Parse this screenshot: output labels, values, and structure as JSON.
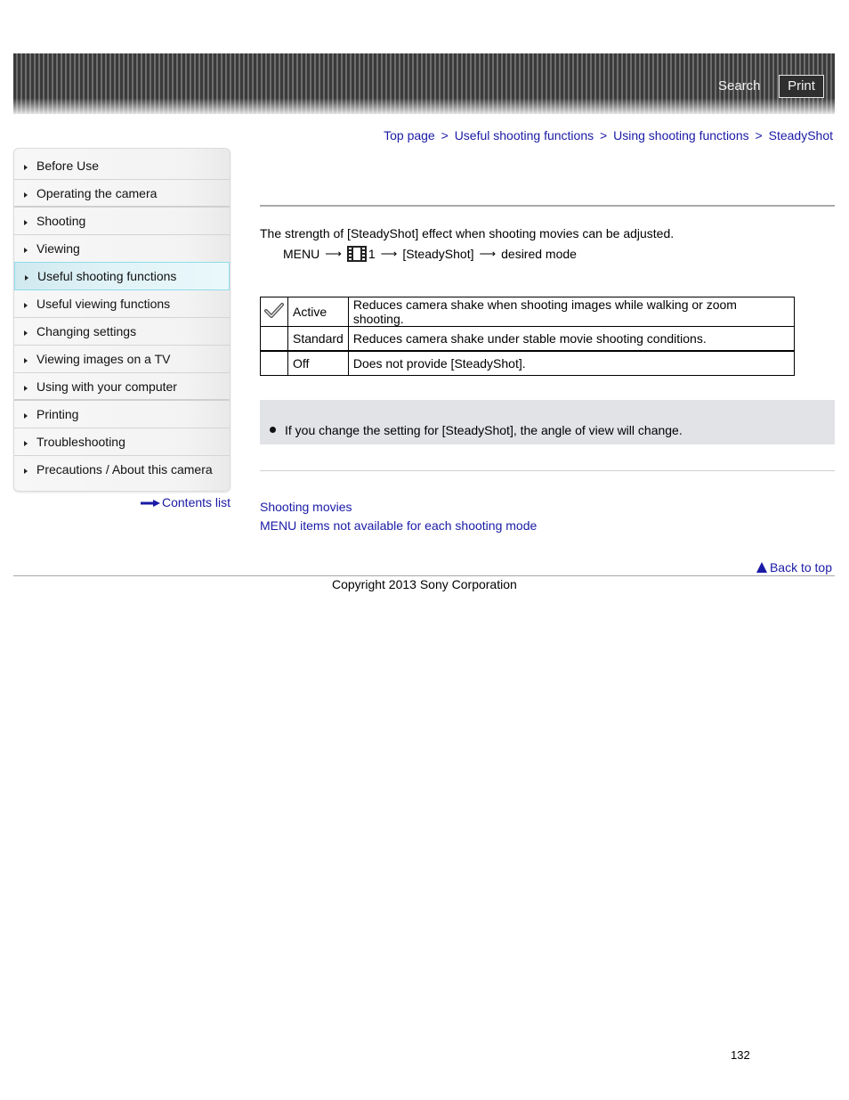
{
  "header": {
    "search_label": "Search",
    "print_label": "Print"
  },
  "breadcrumb": {
    "items": [
      "Top page",
      "Useful shooting functions",
      "Using shooting functions",
      "SteadyShot"
    ],
    "separator": ">"
  },
  "sidebar": {
    "items": [
      {
        "label": "Before Use"
      },
      {
        "label": "Operating the camera"
      },
      {
        "label": "Shooting"
      },
      {
        "label": "Viewing"
      },
      {
        "label": "Useful shooting functions",
        "active": true
      },
      {
        "label": "Useful viewing functions"
      },
      {
        "label": "Changing settings"
      },
      {
        "label": "Viewing images on a TV"
      },
      {
        "label": "Using with your computer"
      },
      {
        "label": "Printing"
      },
      {
        "label": "Troubleshooting"
      },
      {
        "label": "Precautions / About this camera"
      }
    ],
    "contents_list_label": "Contents list"
  },
  "main": {
    "intro": "The strength of [SteadyShot] effect when shooting movies can be adjusted.",
    "menu_path": {
      "menu": "MENU",
      "arrow": "⟶",
      "icon": "movie-film-icon",
      "tab_number": "1",
      "item": "[SteadyShot]",
      "target": "desired mode"
    },
    "modes": [
      {
        "default": true,
        "icon": "checkmark-icon",
        "name": "Active",
        "description": "Reduces camera shake when shooting images while walking or zoom shooting."
      },
      {
        "default": false,
        "name": "Standard",
        "description": "Reduces camera shake under stable movie shooting conditions."
      },
      {
        "default": false,
        "name": "Off",
        "description": "Does not provide [SteadyShot]."
      }
    ],
    "note": "If you change the setting for [SteadyShot], the angle of view will change.",
    "related_links": [
      "Shooting movies",
      "MENU items not available for each shooting mode"
    ]
  },
  "footer": {
    "back_to_top": "Back to top",
    "copyright": "Copyright 2013 Sony Corporation",
    "page_number": "132"
  },
  "colors": {
    "link": "#1a1aa6",
    "note_bg": "#e1e3e7",
    "active_nav_border": "#8fdcec"
  }
}
